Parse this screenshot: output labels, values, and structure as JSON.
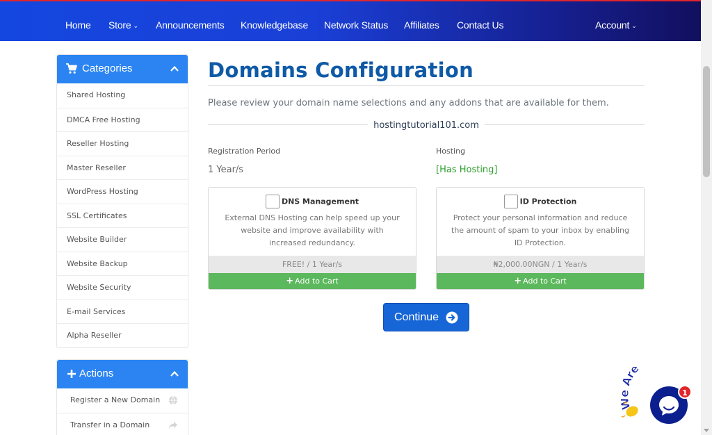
{
  "nav": {
    "items": [
      {
        "label": "Home"
      },
      {
        "label": "Store",
        "dropdown": true
      },
      {
        "label": "Announcements"
      },
      {
        "label": "Knowledgebase"
      },
      {
        "label": "Network Status"
      },
      {
        "label": "Affiliates"
      },
      {
        "label": "Contact Us"
      }
    ],
    "account": {
      "label": "Account",
      "dropdown": true
    }
  },
  "sidebar": {
    "categories": {
      "title": "Categories",
      "icon": "cart-icon",
      "items": [
        "Shared Hosting",
        "DMCA Free Hosting",
        "Reseller Hosting",
        "Master Reseller",
        "WordPress Hosting",
        "SSL Certificates",
        "Website Builder",
        "Website Backup",
        "Website Security",
        "E-mail Services",
        "Alpha Reseller"
      ]
    },
    "actions": {
      "title": "Actions",
      "icon": "plus-icon",
      "items": [
        {
          "label": "Register a New Domain",
          "icon": "globe-icon"
        },
        {
          "label": "Transfer in a Domain",
          "icon": "share-arrow-icon"
        }
      ]
    }
  },
  "main": {
    "title": "Domains Configuration",
    "intro": "Please review your domain name selections and any addons that are available for them.",
    "domain": "hostingtutorial101.com",
    "registration": {
      "label": "Registration Period",
      "value": "1 Year/s"
    },
    "hosting": {
      "label": "Hosting",
      "value": "[Has Hosting]"
    },
    "addons": [
      {
        "name": "DNS Management",
        "description": "External DNS Hosting can help speed up your website and improve availability with increased redundancy.",
        "price": "FREE! / 1 Year/s",
        "cart_label": "Add to Cart",
        "checked": false
      },
      {
        "name": "ID Protection",
        "description": "Protect your personal information and reduce the amount of spam to your inbox by enabling ID Protection.",
        "price": "₦2,000.00NGN / 1 Year/s",
        "cart_label": "Add to Cart",
        "checked": false
      }
    ],
    "continue_label": "Continue"
  },
  "chat": {
    "banner": "We Are Here!",
    "badge": "1"
  },
  "colors": {
    "accent": "#2b84f1",
    "title": "#0f5aa6",
    "success": "#5cb85c",
    "hosting_status": "#2e9d2e",
    "primary_button": "#1766d8"
  }
}
